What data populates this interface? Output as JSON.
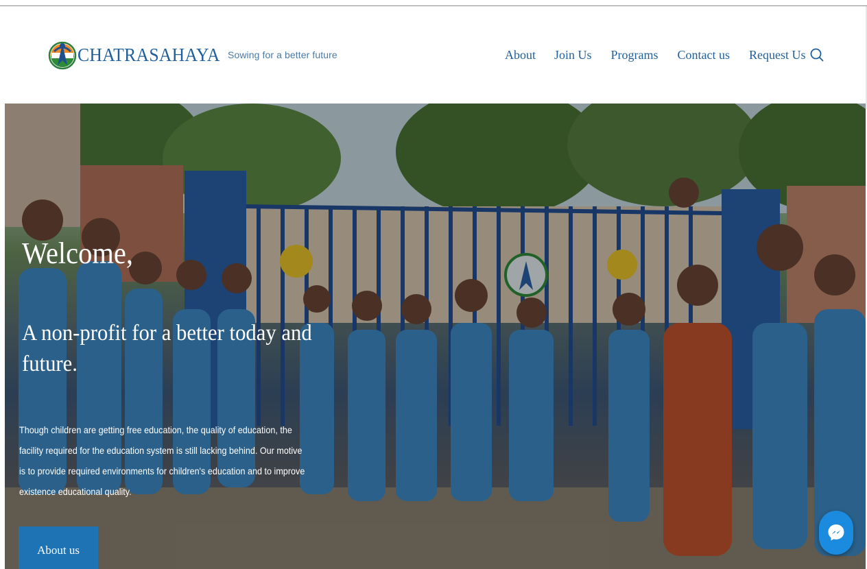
{
  "header": {
    "brand_name": "CHATRASAHAYA",
    "tagline": "Sowing for a better future",
    "nav": [
      "About",
      "Join Us",
      "Programs",
      "Contact us",
      "Request Us"
    ],
    "search_icon": "search-icon"
  },
  "hero": {
    "welcome": "Welcome,",
    "subheading": "A non-profit for a better today and future.",
    "description": "Though children are getting free education, the quality of education, the facility required for the education system is still lacking behind. Our motive is to provide required environments for children's education and to improve existence educational quality.",
    "cta_label": "About us"
  },
  "chat_widget": {
    "icon": "messenger-icon"
  },
  "colors": {
    "brand_blue": "#1f5f9b",
    "cta_blue": "#1e73b5",
    "messenger_blue": "#1b8be0",
    "text_white": "#ffffff"
  }
}
